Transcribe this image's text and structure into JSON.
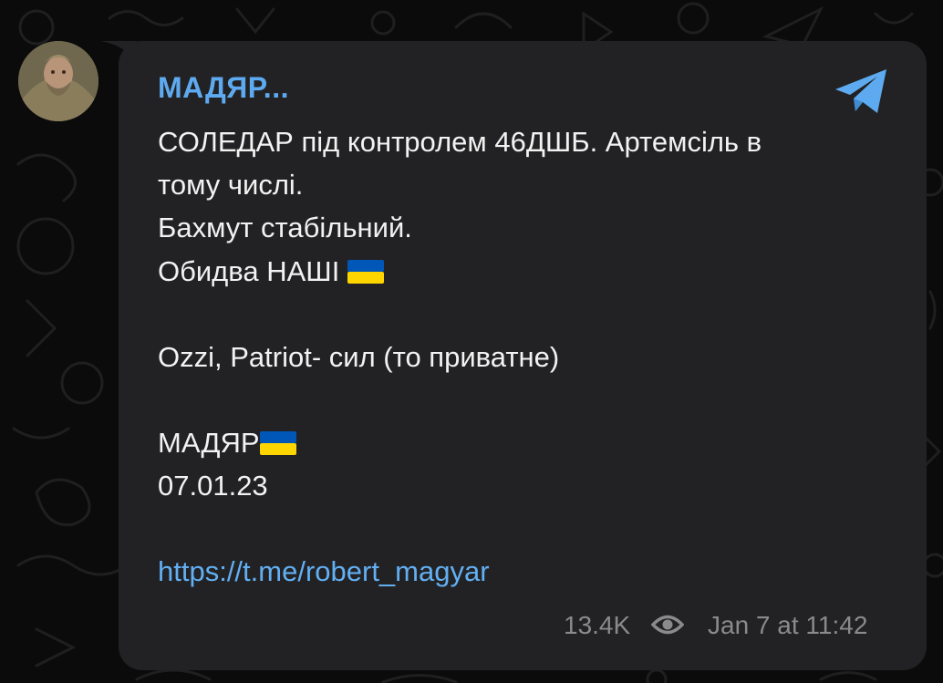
{
  "post": {
    "sender": "МАДЯР...",
    "lines": [
      "СОЛЕДАР під контролем 46ДШБ. Артемсіль в",
      "тому числі.",
      "Бахмут стабільний.",
      "Обидва НАШІ",
      "Ozzi, Patriot- сил (то приватне)",
      "МАДЯР",
      "07.01.23"
    ],
    "link": "https://t.me/robert_magyar",
    "views": "13.4K",
    "timestamp": "Jan 7 at 11:42"
  },
  "icons": {
    "app": "telegram-icon",
    "views": "eye-icon",
    "flag": "ukraine-flag-icon"
  },
  "colors": {
    "bubble": "#222224",
    "sender": "#5eaaf0",
    "link": "#62aff3",
    "text": "#f2f2f2",
    "meta": "#8a8a8c",
    "flag_blue": "#0057b7",
    "flag_yellow": "#ffd500"
  }
}
